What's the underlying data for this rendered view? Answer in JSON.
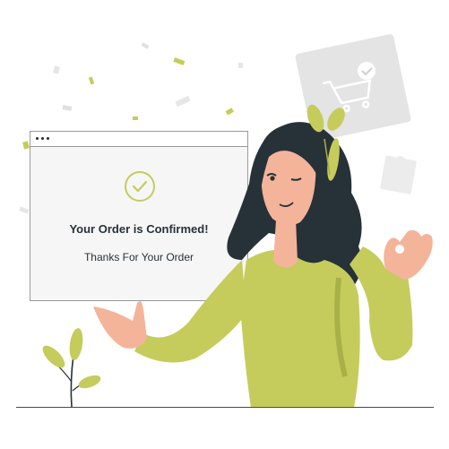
{
  "confirmation": {
    "title": "Your Order is Confirmed!",
    "subtitle": "Thanks For Your Order"
  },
  "colors": {
    "accent": "#c5cc5c",
    "dark": "#263238",
    "skin": "#f4b49a",
    "card": "#e6e6e6"
  },
  "icons": [
    "check-circle-icon",
    "shopping-cart-icon",
    "shopping-bag-icon",
    "plant-icon",
    "confetti"
  ]
}
